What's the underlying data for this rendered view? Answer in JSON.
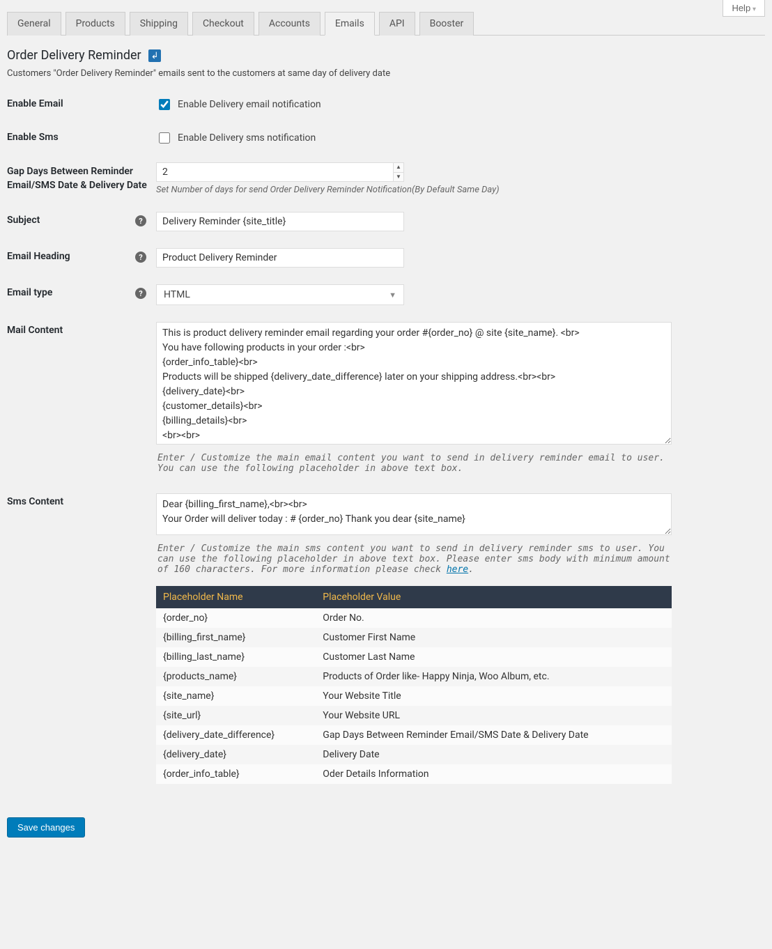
{
  "help_btn": "Help",
  "tabs": [
    "General",
    "Products",
    "Shipping",
    "Checkout",
    "Accounts",
    "Emails",
    "API",
    "Booster"
  ],
  "active_tab": "Emails",
  "page_title": "Order Delivery Reminder",
  "page_desc": "Customers \"Order Delivery Reminder\" emails sent to the customers at same day of delivery date",
  "fields": {
    "enable_email": {
      "label": "Enable Email",
      "checkbox_label": "Enable Delivery email notification",
      "checked": true
    },
    "enable_sms": {
      "label": "Enable Sms",
      "checkbox_label": "Enable Delivery sms notification",
      "checked": false
    },
    "gap_days": {
      "label": "Gap Days Between Reminder Email/SMS Date & Delivery Date",
      "value": "2",
      "hint": "Set Number of days for send Order Delivery Reminder Notification(By Default Same Day)"
    },
    "subject": {
      "label": "Subject",
      "value": "Delivery Reminder {site_title}"
    },
    "heading": {
      "label": "Email Heading",
      "value": "Product Delivery Reminder"
    },
    "email_type": {
      "label": "Email type",
      "value": "HTML"
    },
    "mail": {
      "label": "Mail Content",
      "value": "This is product delivery reminder email regarding your order #{order_no} @ site {site_name}. <br>\nYou have following products in your order :<br>\n{order_info_table}<br>\nProducts will be shipped {delivery_date_difference} later on your shipping address.<br><br>\n{delivery_date}<br>\n{customer_details}<br>\n{billing_details}<br>\n<br><br>\nThank You.<br>\n{site_name}",
      "hint": "Enter / Customize the main email content you want to send in delivery reminder email to user. You can use the following placeholder in above text box."
    },
    "sms": {
      "label": "Sms Content",
      "value": "Dear {billing_first_name},<br><br>\nYour Order will deliver today : # {order_no} Thank you dear {site_name}",
      "hint_prefix": "Enter / Customize the main sms content you want to send in delivery reminder sms to user. You can use the following placeholder in above text box. Please enter sms body with minimum amount of 160 characters. For more information please check ",
      "hint_link": "here",
      "hint_suffix": "."
    }
  },
  "placeholders": {
    "col_name": "Placeholder Name",
    "col_value": "Placeholder Value",
    "rows": [
      {
        "name": "{order_no}",
        "value": "Order No."
      },
      {
        "name": "{billing_first_name}",
        "value": "Customer First Name"
      },
      {
        "name": "{billing_last_name}",
        "value": "Customer Last Name"
      },
      {
        "name": "{products_name}",
        "value": "Products of Order like- Happy Ninja, Woo Album, etc."
      },
      {
        "name": "{site_name}",
        "value": "Your Website Title"
      },
      {
        "name": "{site_url}",
        "value": "Your Website URL"
      },
      {
        "name": "{delivery_date_difference}",
        "value": "Gap Days Between Reminder Email/SMS Date & Delivery Date"
      },
      {
        "name": "{delivery_date}",
        "value": "Delivery Date"
      },
      {
        "name": "{order_info_table}",
        "value": "Oder Details Information"
      }
    ]
  },
  "save_label": "Save changes"
}
